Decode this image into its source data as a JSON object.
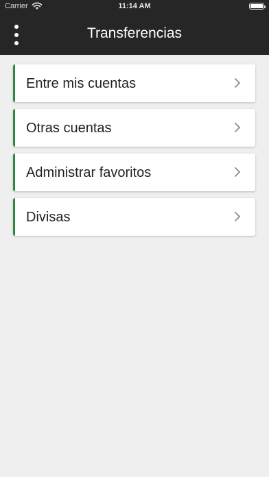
{
  "status_bar": {
    "carrier": "Carrier",
    "time": "11:14 AM",
    "wifi_icon": "wifi-icon",
    "battery_icon": "battery-icon"
  },
  "header": {
    "title": "Transferencias",
    "menu_icon": "more-vertical-icon",
    "background": "#262626"
  },
  "menu": {
    "items": [
      {
        "label": "Entre mis cuentas"
      },
      {
        "label": "Otras cuentas"
      },
      {
        "label": "Administrar favoritos"
      },
      {
        "label": "Divisas"
      }
    ],
    "accent": "#2f8a3f",
    "chevron_icon": "chevron-right-icon"
  }
}
